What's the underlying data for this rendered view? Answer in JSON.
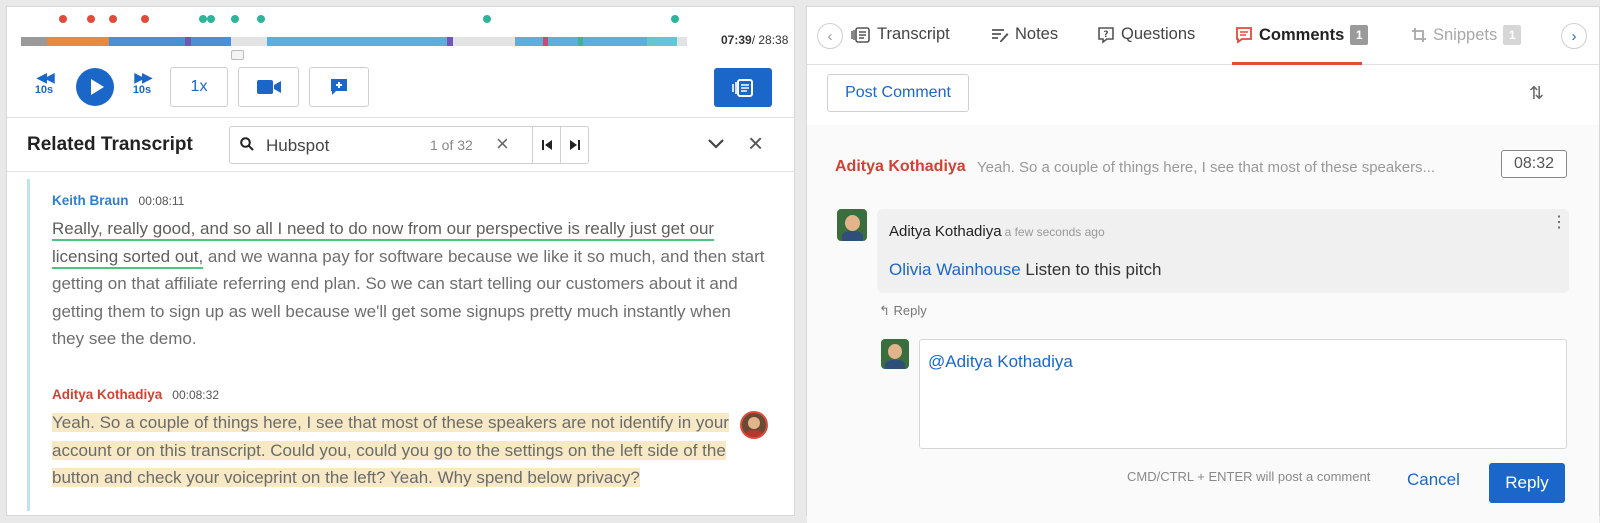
{
  "player": {
    "current_time": "07:39",
    "total_time": "/ 28:38",
    "skip_back_label": "10s",
    "skip_forward_label": "10s",
    "speed_label": "1x",
    "progress_fraction": 0.267
  },
  "related_transcript": {
    "title": "Related Transcript",
    "search_value": "Hubspot",
    "search_count": "1 of 32"
  },
  "transcript": [
    {
      "speaker": "Keith Braun",
      "time": "00:08:11",
      "text_underlined": "Really, really good, and so all I need to do now from our perspective is really just get our licensing sorted out,",
      "text_rest": " and we wanna pay for software because we like it so much, and then start getting on that affiliate referring end plan. So we can start telling our customers about it and getting them to sign up as well because we'll get some signups pretty much instantly when they see the demo."
    },
    {
      "speaker": "Aditya Kothadiya",
      "time": "00:08:32",
      "text": "Yeah. So a couple of things here, I see that most of these speakers are not identify in your account or on this transcript. Could you, could you go to the settings on the left side of the button and check your voiceprint on the left? Yeah. Why spend below privacy?"
    }
  ],
  "tabs": [
    {
      "label": "Transcript"
    },
    {
      "label": "Notes"
    },
    {
      "label": "Questions"
    },
    {
      "label": "Comments",
      "count": "1"
    },
    {
      "label": "Snippets",
      "count": "1"
    }
  ],
  "comments": {
    "post_label": "Post Comment",
    "thread": {
      "author": "Aditya Kothadiya",
      "excerpt": "Yeah. So a couple of things here, I see that most of these speakers...",
      "time": "08:32"
    },
    "comment": {
      "author": "Aditya Kothadiya",
      "when": "a few seconds ago",
      "mention": "Olivia Wainhouse",
      "body": " Listen to this pitch"
    },
    "reply_link": "Reply",
    "reply_value": "@Aditya Kothadiya",
    "hint": "CMD/CTRL + ENTER will post a comment",
    "cancel_label": "Cancel",
    "reply_label": "Reply"
  },
  "colors": {
    "accent": "#1b67c9",
    "speaker_keith": "#2f7fcf",
    "speaker_aditya": "#d04234",
    "active_tab_underline": "#e14b3b"
  }
}
